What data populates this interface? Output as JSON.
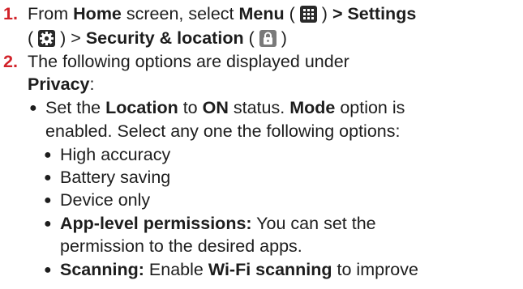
{
  "step1": {
    "number": "1.",
    "from": "From",
    "home": "Home",
    "screen_select": "screen, select",
    "menu": "Menu",
    "settings_sep": "> Settings",
    "security": "Security & location",
    "sep_gt": ">",
    "paren_open": "(",
    "paren_close": ")",
    "icons": [
      "grid-menu-icon",
      "settings-gear-icon",
      "lock-icon"
    ]
  },
  "step2": {
    "number": "2.",
    "text": "The following options are displayed under",
    "privacy": "Privacy",
    "colon": ":"
  },
  "bullet1": {
    "set_the": "Set the",
    "location": "Location",
    "to": "to",
    "on": "ON",
    "status": "status.",
    "mode": "Mode",
    "option_is": "option is",
    "line2": "enabled. Select any one the following options:"
  },
  "mode_options": [
    "High accuracy",
    "Battery saving",
    "Device only"
  ],
  "app_perm": {
    "label": "App-level permissions:",
    "text1": "You can set the",
    "text2": "permission to the desired apps."
  },
  "scanning": {
    "label": "Scanning:",
    "enable": "Enable",
    "wifi": "Wi-Fi scanning",
    "text": "to improve"
  },
  "colors": {
    "step_number": "#d2232a",
    "text": "#1d1d1d"
  }
}
